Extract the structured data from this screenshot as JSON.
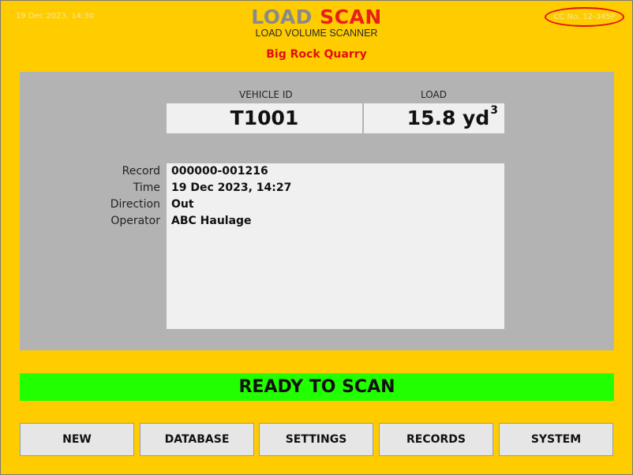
{
  "header": {
    "datetime": "19 Dec 2023, 14:30",
    "cc_number": "CC No. 12-345P",
    "logo_left": "LOAD",
    "logo_right": "SCAN",
    "logo_subtitle": "LOAD VOLUME SCANNER",
    "site_name": "Big Rock Quarry"
  },
  "vehicle": {
    "id_label": "VEHICLE ID",
    "id_value": "T1001",
    "load_label": "LOAD",
    "load_value": "15.8 yd",
    "load_unit_sup": "3"
  },
  "record": {
    "fields": [
      {
        "label": "Record",
        "value": "000000-001216"
      },
      {
        "label": "Time",
        "value": "19 Dec 2023, 14:27"
      },
      {
        "label": "Direction",
        "value": "Out"
      },
      {
        "label": "Operator",
        "value": "ABC Haulage"
      }
    ]
  },
  "status": {
    "text": "READY TO SCAN",
    "color": "#22ff00"
  },
  "buttons": [
    {
      "label": "NEW"
    },
    {
      "label": "DATABASE"
    },
    {
      "label": "SETTINGS"
    },
    {
      "label": "RECORDS"
    },
    {
      "label": "SYSTEM"
    }
  ],
  "colors": {
    "background": "#ffcc00",
    "panel": "#b3b3b3",
    "accent_red": "#e01010"
  }
}
